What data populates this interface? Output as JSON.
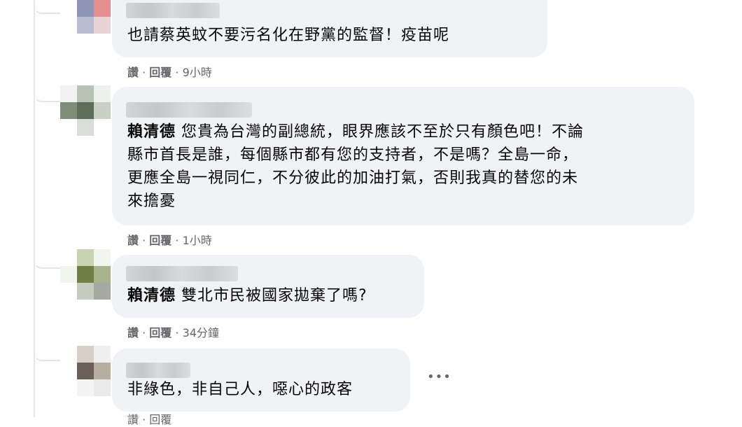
{
  "comments": [
    {
      "mention": "",
      "text": "也請蔡英蚊不要污名化在野黨的監督！疫苗呢",
      "lines": [],
      "like": "讚",
      "reply": "回覆",
      "time": "9小時"
    },
    {
      "mention": "賴清德",
      "text": "您貴為台灣的副總統，眼界應該不至於只有顏色吧！不論",
      "lines": [
        "縣市首長是誰，每個縣市都有您的支持者，不是嗎？全島一命，",
        "更應全島一視同仁，不分彼此的加油打氣，否則我真的替您的未",
        "來擔憂"
      ],
      "like": "讚",
      "reply": "回覆",
      "time": "1小時"
    },
    {
      "mention": "賴清德",
      "text": "雙北市民被國家拋棄了嗎?",
      "lines": [],
      "like": "讚",
      "reply": "回覆",
      "time": "34分鐘"
    },
    {
      "mention": "",
      "text": "非綠色，非自己人，噁心的政客",
      "lines": [],
      "like": "讚",
      "reply": "回覆",
      "time": ""
    }
  ],
  "separator": "·",
  "more_icon": "more-horizontal-icon",
  "colors": {
    "bubble": "#f0f2f5",
    "meta": "#65676b",
    "text": "#050505"
  }
}
